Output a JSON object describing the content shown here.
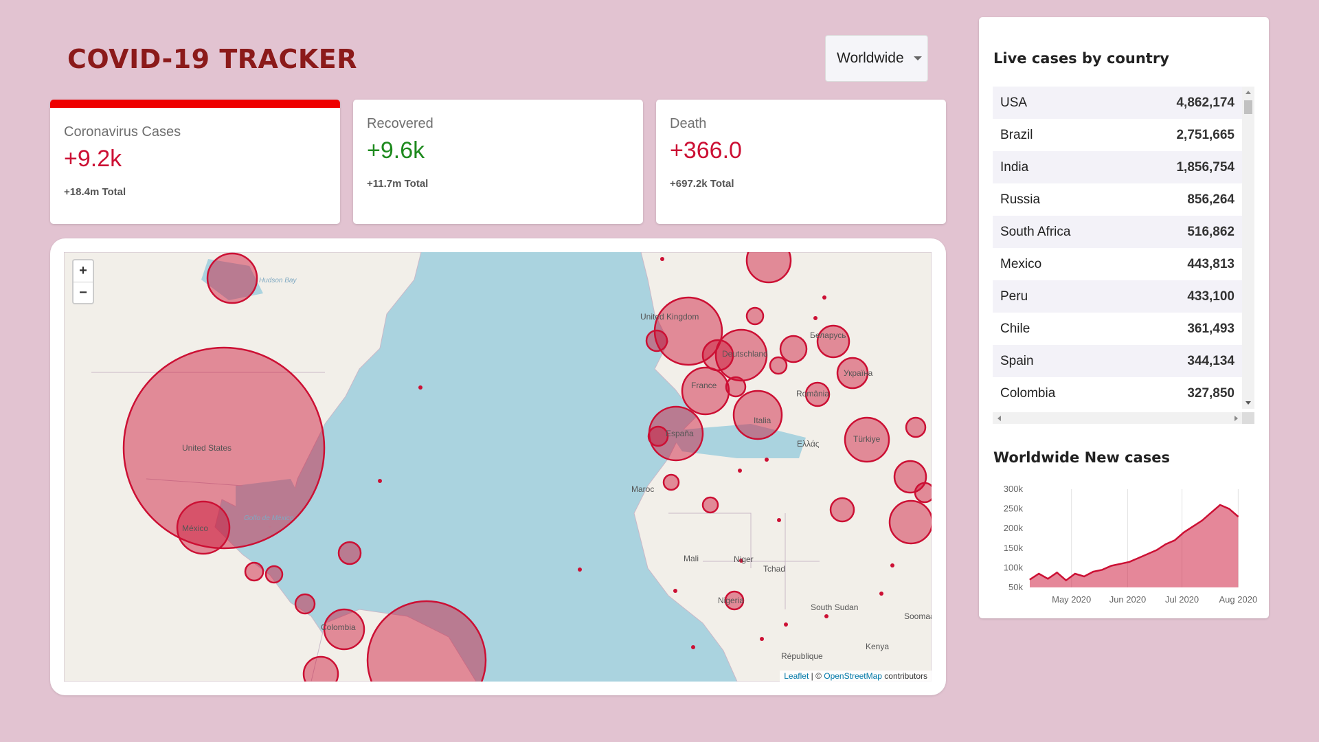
{
  "app": {
    "title": "COVID-19 TRACKER"
  },
  "region_select": {
    "value": "Worldwide"
  },
  "stats": [
    {
      "label": "Coronavirus Cases",
      "value": "+9.2k",
      "total": "+18.4m Total"
    },
    {
      "label": "Recovered",
      "value": "+9.6k",
      "total": "+11.7m Total"
    },
    {
      "label": "Death",
      "value": "+366.0",
      "total": "+697.2k Total"
    }
  ],
  "map": {
    "zoom_in": "+",
    "zoom_out": "−",
    "attribution": {
      "leaflet": "Leaflet",
      "sep": " | © ",
      "osm": "OpenStreetMap",
      "suffix": " contributors"
    },
    "labels": [
      {
        "name": "United States",
        "text": "United States"
      },
      {
        "name": "Mexico",
        "text": "México"
      },
      {
        "name": "United Kingdom",
        "text": "United Kingdom"
      },
      {
        "name": "France",
        "text": "France"
      },
      {
        "name": "Deutschland",
        "text": "Deutschland"
      },
      {
        "name": "Italia",
        "text": "Italia"
      },
      {
        "name": "España",
        "text": "España"
      },
      {
        "name": "Türkiye",
        "text": "Türkiye"
      },
      {
        "name": "Colombia",
        "text": "Colombia"
      },
      {
        "name": "Hudson Bay",
        "text": "Hudson Bay"
      },
      {
        "name": "Golfo de México",
        "text": "Golfo de México"
      },
      {
        "name": "Maroc",
        "text": "Maroc"
      },
      {
        "name": "Mali",
        "text": "Mali"
      },
      {
        "name": "Niger",
        "text": "Niger"
      },
      {
        "name": "Tchad",
        "text": "Tchad"
      },
      {
        "name": "South Sudan",
        "text": "South Sudan"
      },
      {
        "name": "Nigeria",
        "text": "Nigeria"
      },
      {
        "name": "Kenya",
        "text": "Kenya"
      },
      {
        "name": "Україна",
        "text": "Україна"
      },
      {
        "name": "România",
        "text": "România"
      },
      {
        "name": "Беларусь",
        "text": "Беларусь"
      },
      {
        "name": "Ελλάς",
        "text": "Ελλάς"
      },
      {
        "name": "République démocratique",
        "text": "République"
      },
      {
        "name": "Somalia",
        "text": "Soomaa"
      }
    ]
  },
  "live_cases": {
    "title": "Live cases by country",
    "rows": [
      {
        "country": "USA",
        "cases": "4,862,174"
      },
      {
        "country": "Brazil",
        "cases": "2,751,665"
      },
      {
        "country": "India",
        "cases": "1,856,754"
      },
      {
        "country": "Russia",
        "cases": "856,264"
      },
      {
        "country": "South Africa",
        "cases": "516,862"
      },
      {
        "country": "Mexico",
        "cases": "443,813"
      },
      {
        "country": "Peru",
        "cases": "433,100"
      },
      {
        "country": "Chile",
        "cases": "361,493"
      },
      {
        "country": "Spain",
        "cases": "344,134"
      },
      {
        "country": "Colombia",
        "cases": "327,850"
      }
    ]
  },
  "new_cases": {
    "title": "Worldwide New cases"
  },
  "chart_data": {
    "type": "area",
    "title": "Worldwide New cases",
    "color": "#cc1034",
    "fill": "rgba(204,16,52,0.5)",
    "x_ticks": [
      "May 2020",
      "Jun 2020",
      "Jul 2020",
      "Aug 2020"
    ],
    "y_ticks": [
      "300k",
      "250k",
      "200k",
      "150k",
      "100k",
      "50k"
    ],
    "y_tick_values": [
      300000,
      250000,
      200000,
      150000,
      100000,
      50000
    ],
    "ylim": [
      50000,
      300000
    ],
    "x_range": [
      "2020-04-08",
      "2020-08-02"
    ],
    "x_tick_dates": [
      "2020-05-01",
      "2020-06-01",
      "2020-07-01",
      "2020-08-01"
    ],
    "x": [
      "2020-04-08",
      "2020-04-13",
      "2020-04-18",
      "2020-04-23",
      "2020-04-28",
      "2020-05-03",
      "2020-05-08",
      "2020-05-13",
      "2020-05-18",
      "2020-05-23",
      "2020-05-28",
      "2020-06-02",
      "2020-06-07",
      "2020-06-12",
      "2020-06-17",
      "2020-06-22",
      "2020-06-27",
      "2020-07-02",
      "2020-07-07",
      "2020-07-12",
      "2020-07-17",
      "2020-07-22",
      "2020-07-27",
      "2020-08-01"
    ],
    "values": [
      70000,
      85000,
      72000,
      88000,
      68000,
      85000,
      78000,
      90000,
      95000,
      105000,
      110000,
      115000,
      125000,
      135000,
      145000,
      160000,
      170000,
      190000,
      205000,
      220000,
      240000,
      260000,
      250000,
      230000
    ]
  }
}
